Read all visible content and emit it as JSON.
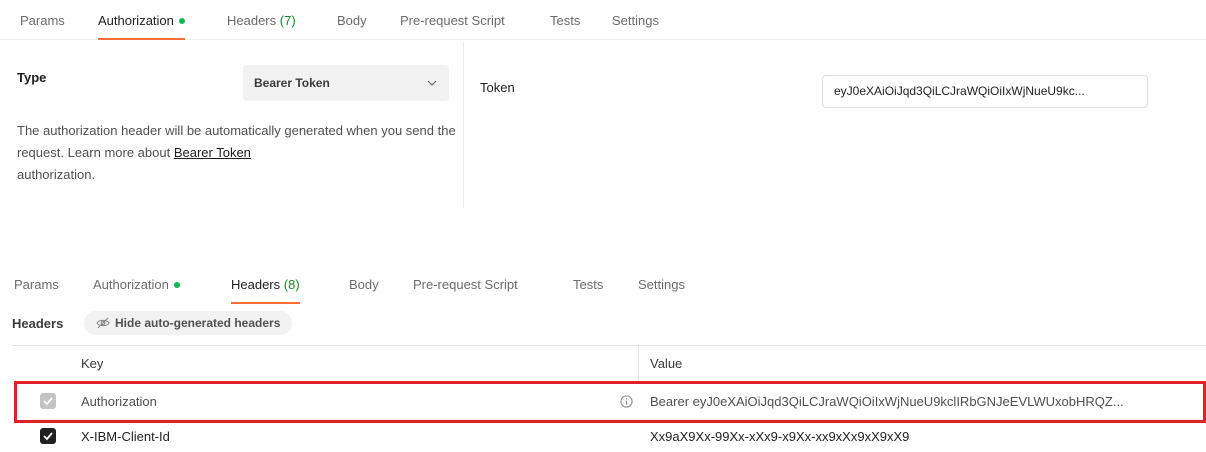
{
  "top_tabs": {
    "params": "Params",
    "authorization": "Authorization",
    "headers": "Headers",
    "headers_count": "(7)",
    "body": "Body",
    "pre_request": "Pre-request Script",
    "tests": "Tests",
    "settings": "Settings"
  },
  "auth": {
    "type_label": "Type",
    "type_value": "Bearer Token",
    "desc_text": "The authorization header will be automatically generated when you send the request. Learn more about ",
    "desc_link": "Bearer Token",
    "desc_suffix": "authorization.",
    "token_label": "Token",
    "token_value": "eyJ0eXAiOiJqd3QiLCJraWQiOiIxWjNueU9kc..."
  },
  "bottom_tabs": {
    "params": "Params",
    "authorization": "Authorization",
    "headers": "Headers",
    "headers_count": "(8)",
    "body": "Body",
    "pre_request": "Pre-request Script",
    "tests": "Tests",
    "settings": "Settings"
  },
  "headers_section": {
    "label": "Headers",
    "hide_button": "Hide auto-generated headers"
  },
  "table": {
    "columns": {
      "key": "Key",
      "value": "Value"
    },
    "rows": [
      {
        "key": "Authorization",
        "value": "Bearer eyJ0eXAiOiJqd3QiLCJraWQiOiIxWjNueU9kclIRbGNJeEVLWUxobHRQZ..."
      },
      {
        "key": "X-IBM-Client-Id",
        "value": "Xx9aX9Xx-99Xx-xXx9-x9Xx-xx9xXx9xX9xX9"
      }
    ]
  },
  "colors": {
    "accent": "#ff6c37",
    "status_dot": "#0cbb52",
    "highlight": "#e2202a"
  }
}
